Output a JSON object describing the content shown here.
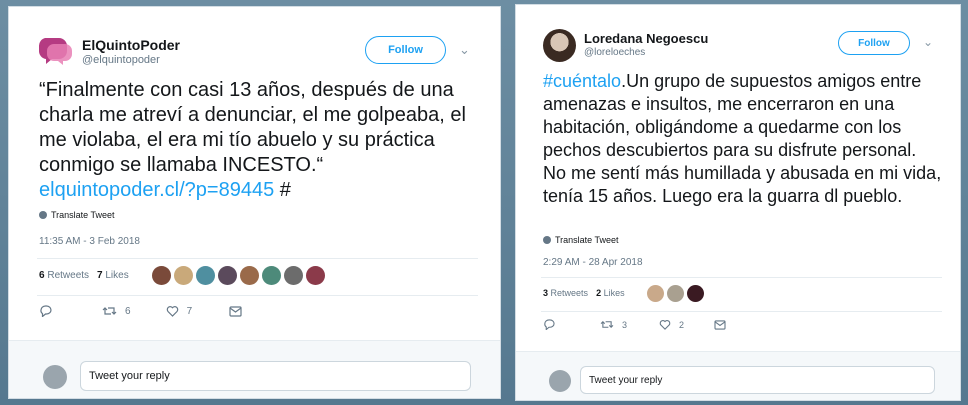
{
  "tweet1": {
    "name": "ElQuintoPoder",
    "handle": "@elquintopoder",
    "follow_label": "Follow",
    "text": "“Finalmente con casi 13 años, después de una charla me atreví a denunciar, el me golpeaba, el me violaba, el era mi tío abuelo y su práctica conmigo se llamaba INCESTO.“",
    "link": "elquintopoder.cl/?p=89445",
    "after_link": " #",
    "translate": "Translate Tweet",
    "time": "11:35 AM - 3 Feb 2018",
    "retweets_count": "6",
    "retweets_label": "Retweets",
    "likes_count": "7",
    "likes_label": "Likes",
    "action_retweets": "6",
    "action_likes": "7",
    "reply_placeholder": "Tweet your reply",
    "colors": {
      "logo": "#b53b82",
      "logo2": "#d6498c"
    }
  },
  "tweet2": {
    "name": "Loredana Negoescu",
    "handle": "@loreloeches",
    "follow_label": "Follow",
    "hashtag": "#cuéntalo",
    "text": ".Un grupo de supuestos amigos entre amenazas e insultos, me encerraron en una habitación, obligándome a quedarme con los pechos descubiertos para su disfrute personal. No me sentí más humillada y abusada en mi vida, tenía 15 años. Luego era la guarra dl pueblo.",
    "translate": "Translate Tweet",
    "time": "2:29 AM - 28 Apr 2018",
    "retweets_count": "3",
    "retweets_label": "Retweets",
    "likes_count": "2",
    "likes_label": "Likes",
    "action_retweets": "3",
    "action_likes": "2",
    "reply_placeholder": "Tweet your reply"
  },
  "icons": {
    "reply": "reply-icon",
    "retweet": "retweet-icon",
    "like": "heart-icon",
    "dm": "envelope-icon",
    "chevron": "chevron-down-icon",
    "globe": "globe-icon"
  },
  "accent": "#1da1f2"
}
